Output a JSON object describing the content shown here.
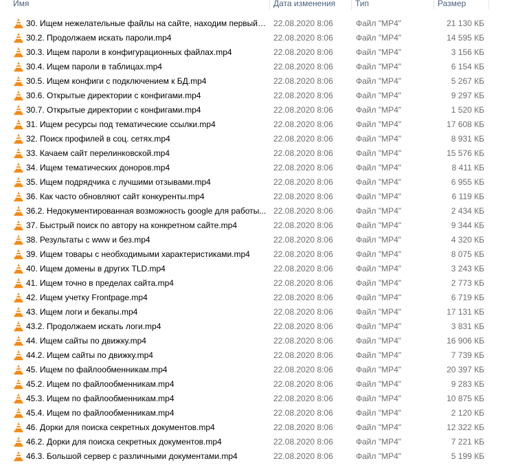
{
  "header": {
    "name": "Имя",
    "date": "Дата изменения",
    "type": "Тип",
    "size": "Размер"
  },
  "colors": {
    "header_text": "#4c607a",
    "meta_text": "#6d6d6d",
    "vlc_orange": "#f48a14",
    "vlc_stripe": "#ffffff"
  },
  "file_icon": "vlc-cone-icon",
  "files": [
    {
      "name": "30. Ищем нежелательные файлы на сайте, находим первый ...",
      "date": "22.08.2020 8:06",
      "type": "Файл \"MP4\"",
      "size": "21 130 КБ"
    },
    {
      "name": "30.2. Продолжаем искать пароли.mp4",
      "date": "22.08.2020 8:06",
      "type": "Файл \"MP4\"",
      "size": "14 595 КБ"
    },
    {
      "name": "30.3. Ищем пароли в конфигурационных файлах.mp4",
      "date": "22.08.2020 8:06",
      "type": "Файл \"MP4\"",
      "size": "3 156 КБ"
    },
    {
      "name": "30.4. Ищем пароли в таблицах.mp4",
      "date": "22.08.2020 8:06",
      "type": "Файл \"MP4\"",
      "size": "6 154 КБ"
    },
    {
      "name": "30.5. Ищем конфиги с подключением к БД.mp4",
      "date": "22.08.2020 8:06",
      "type": "Файл \"MP4\"",
      "size": "5 267 КБ"
    },
    {
      "name": "30.6. Открытые директории с конфигами.mp4",
      "date": "22.08.2020 8:06",
      "type": "Файл \"MP4\"",
      "size": "9 297 КБ"
    },
    {
      "name": "30.7. Открытые директории с конфигами.mp4",
      "date": "22.08.2020 8:06",
      "type": "Файл \"MP4\"",
      "size": "1 520 КБ"
    },
    {
      "name": "31. Ищем ресурсы под тематические ссылки.mp4",
      "date": "22.08.2020 8:06",
      "type": "Файл \"MP4\"",
      "size": "17 608 КБ"
    },
    {
      "name": "32. Поиск профилей в соц. сетях.mp4",
      "date": "22.08.2020 8:06",
      "type": "Файл \"MP4\"",
      "size": "8 931 КБ"
    },
    {
      "name": "33. Качаем сайт перелинковской.mp4",
      "date": "22.08.2020 8:06",
      "type": "Файл \"MP4\"",
      "size": "15 576 КБ"
    },
    {
      "name": "34. Ищем тематических доноров.mp4",
      "date": "22.08.2020 8:06",
      "type": "Файл \"MP4\"",
      "size": "8 411 КБ"
    },
    {
      "name": "35. Ищем подрядчика с лучшими отзывами.mp4",
      "date": "22.08.2020 8:06",
      "type": "Файл \"MP4\"",
      "size": "6 955 КБ"
    },
    {
      "name": "36. Как часто обновляют сайт конкуренты.mp4",
      "date": "22.08.2020 8:06",
      "type": "Файл \"MP4\"",
      "size": "6 119 КБ"
    },
    {
      "name": "36.2. Недокументированная возможность google для работы...",
      "date": "22.08.2020 8:06",
      "type": "Файл \"MP4\"",
      "size": "2 434 КБ"
    },
    {
      "name": "37. Быстрый поиск по автору на конкретном сайте.mp4",
      "date": "22.08.2020 8:06",
      "type": "Файл \"MP4\"",
      "size": "9 344 КБ"
    },
    {
      "name": "38. Результаты с www и без.mp4",
      "date": "22.08.2020 8:06",
      "type": "Файл \"MP4\"",
      "size": "4 320 КБ"
    },
    {
      "name": "39. Ищем товары с необходимыми характеристиками.mp4",
      "date": "22.08.2020 8:06",
      "type": "Файл \"MP4\"",
      "size": "8 075 КБ"
    },
    {
      "name": "40. Ищем домены в других TLD.mp4",
      "date": "22.08.2020 8:06",
      "type": "Файл \"MP4\"",
      "size": "3 243 КБ"
    },
    {
      "name": "41. Ищем точно в пределах сайта.mp4",
      "date": "22.08.2020 8:06",
      "type": "Файл \"MP4\"",
      "size": "2 773 КБ"
    },
    {
      "name": "42. Ищем учетку Frontpage.mp4",
      "date": "22.08.2020 8:06",
      "type": "Файл \"MP4\"",
      "size": "6 719 КБ"
    },
    {
      "name": "43. Ищем логи и бекапы.mp4",
      "date": "22.08.2020 8:06",
      "type": "Файл \"MP4\"",
      "size": "17 131 КБ"
    },
    {
      "name": "43.2. Продолжаем искать логи.mp4",
      "date": "22.08.2020 8:06",
      "type": "Файл \"MP4\"",
      "size": "3 831 КБ"
    },
    {
      "name": "44. Ищем сайты по движку.mp4",
      "date": "22.08.2020 8:06",
      "type": "Файл \"MP4\"",
      "size": "16 906 КБ"
    },
    {
      "name": "44.2. Ищем сайты по движку.mp4",
      "date": "22.08.2020 8:06",
      "type": "Файл \"MP4\"",
      "size": "7 739 КБ"
    },
    {
      "name": "45. Ищем по файлообменникам.mp4",
      "date": "22.08.2020 8:06",
      "type": "Файл \"MP4\"",
      "size": "20 397 КБ"
    },
    {
      "name": "45.2. Ищем по файлообменникам.mp4",
      "date": "22.08.2020 8:06",
      "type": "Файл \"MP4\"",
      "size": "9 283 КБ"
    },
    {
      "name": "45.3. Ищем по файлообменникам.mp4",
      "date": "22.08.2020 8:06",
      "type": "Файл \"MP4\"",
      "size": "10 875 КБ"
    },
    {
      "name": "45.4. Ищем по файлообменникам.mp4",
      "date": "22.08.2020 8:06",
      "type": "Файл \"MP4\"",
      "size": "2 120 КБ"
    },
    {
      "name": "46. Дорки для поиска секретных документов.mp4",
      "date": "22.08.2020 8:06",
      "type": "Файл \"MP4\"",
      "size": "12 322 КБ"
    },
    {
      "name": "46.2. Дорки для поиска секретных документов.mp4",
      "date": "22.08.2020 8:06",
      "type": "Файл \"MP4\"",
      "size": "7 221 КБ"
    },
    {
      "name": "46.3. Большой сервер с различными документами.mp4",
      "date": "22.08.2020 8:06",
      "type": "Файл \"MP4\"",
      "size": "5 199 КБ"
    }
  ]
}
